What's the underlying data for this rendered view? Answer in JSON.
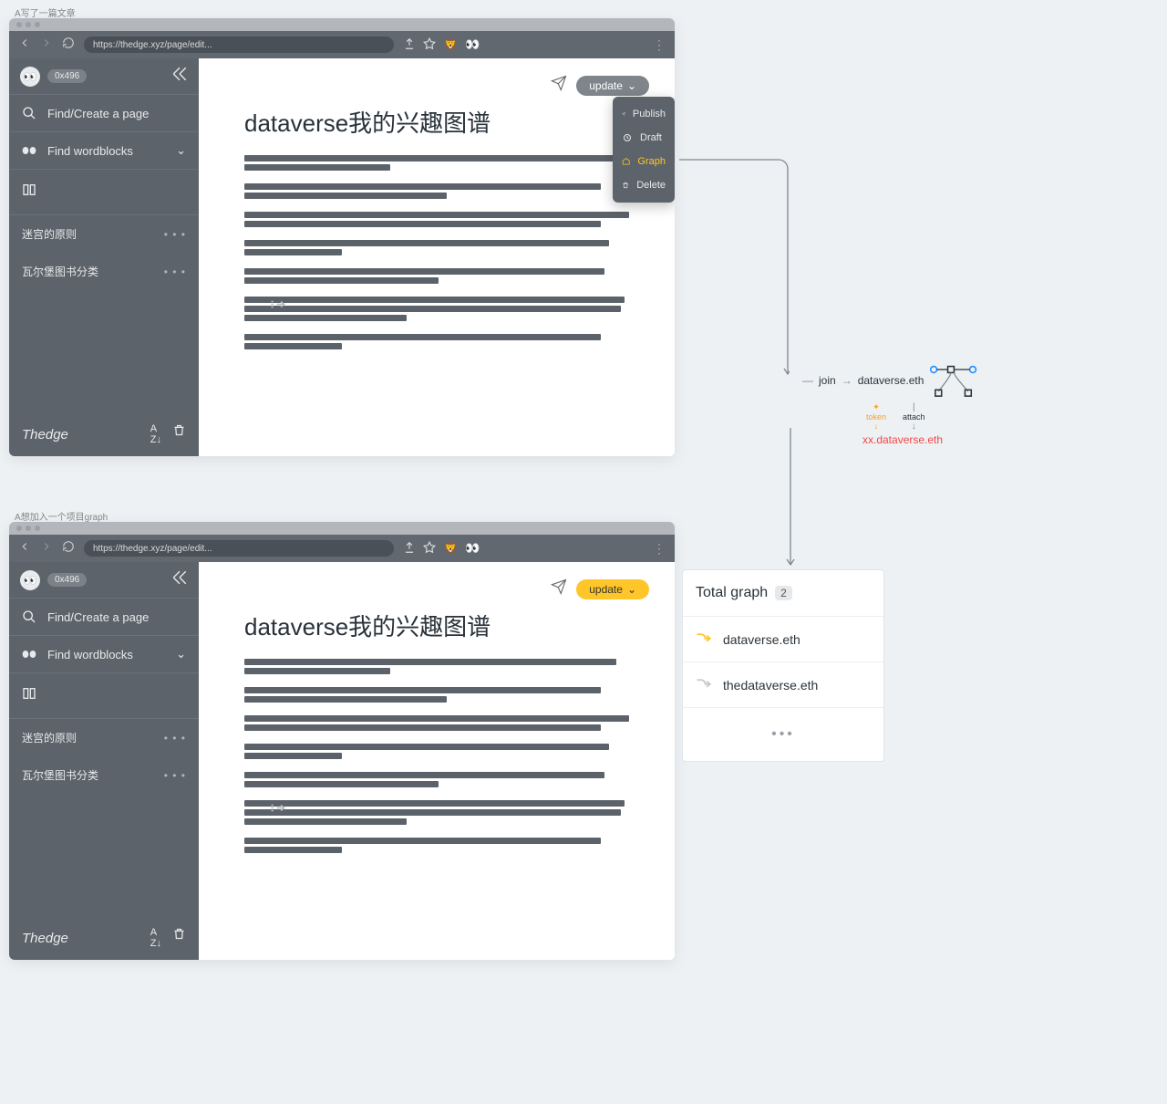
{
  "caption1": "A写了一篇文章",
  "caption2": "A想加入一个项目graph",
  "browser": {
    "url": "https://thedge.xyz/page/edit...",
    "emoji1": "🦁",
    "emoji2": "👀"
  },
  "sidebar": {
    "badge": "0x496",
    "search_label": "Find/Create a page",
    "word_label": "Find wordblocks",
    "items": [
      "迷宫的原则",
      "瓦尔堡图书分类"
    ],
    "brand": "Thedge",
    "sort_label": "A↓Z"
  },
  "doc": {
    "title": "dataverse我的兴趣图谱"
  },
  "update": {
    "label": "update",
    "menu": {
      "publish": "Publish",
      "draft": "Draft",
      "graph": "Graph",
      "delete": "Delete"
    }
  },
  "diagram": {
    "join": "join",
    "node": "dataverse.eth",
    "token": "token",
    "attach": "attach",
    "sub": "xx.dataverse.eth"
  },
  "panel": {
    "title": "Total graph",
    "count": "2",
    "items": [
      "dataverse.eth",
      "thedataverse.eth"
    ]
  }
}
